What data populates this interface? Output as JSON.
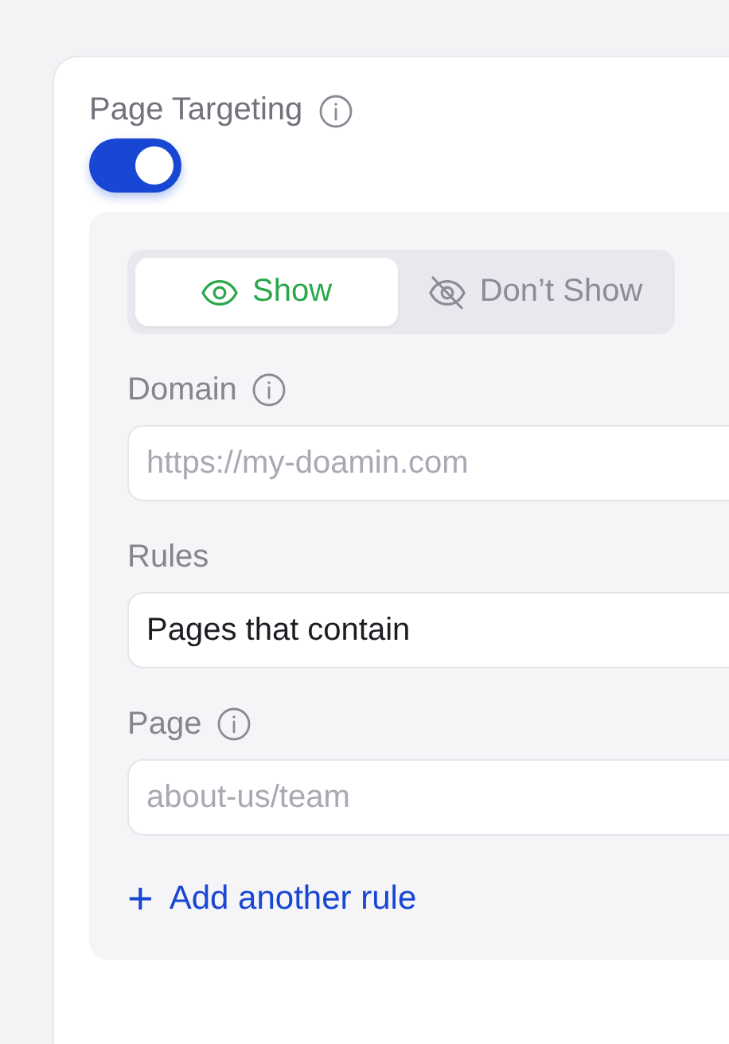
{
  "section": {
    "title": "Page Targeting",
    "enabled": true
  },
  "visibility_tabs": [
    {
      "label": "Show",
      "kind": "show",
      "selected": true
    },
    {
      "label": "Don’t Show",
      "kind": "hide",
      "selected": false
    }
  ],
  "fields": [
    {
      "label": "Domain",
      "info": true,
      "placeholder": "https://my-doamin.com"
    },
    {
      "label": "Rules",
      "info": false,
      "value": "Pages that contain"
    },
    {
      "label": "Page",
      "info": true,
      "placeholder": "about-us/team"
    }
  ],
  "add_rule": {
    "icon": "+",
    "label": "Add another rule"
  }
}
